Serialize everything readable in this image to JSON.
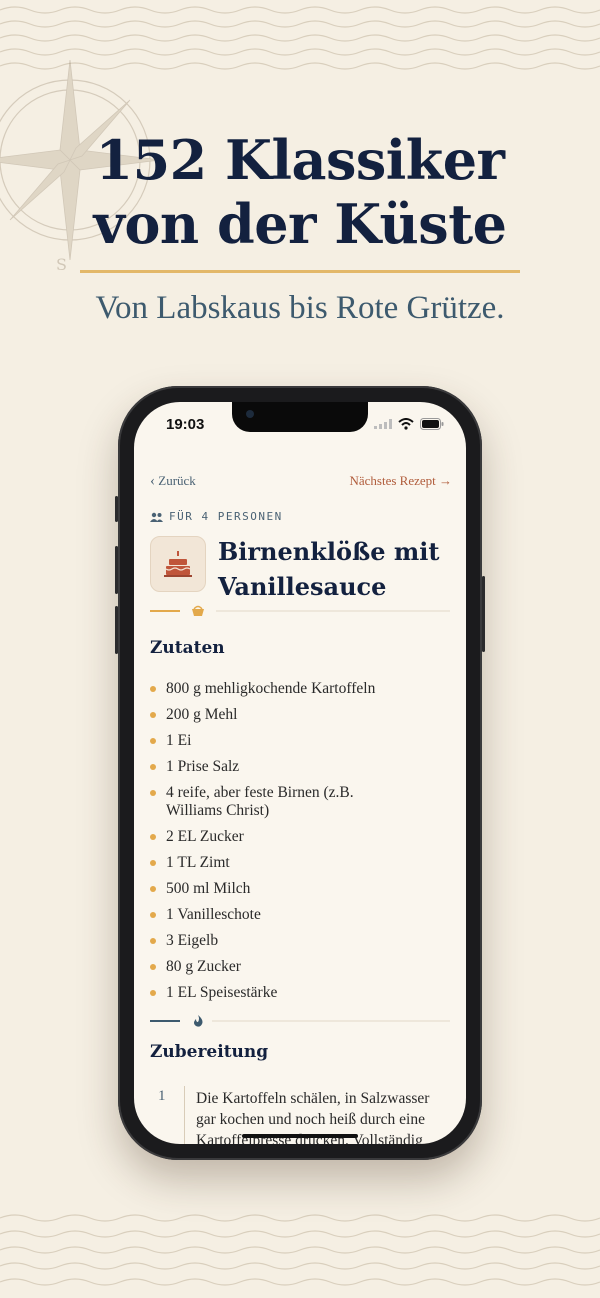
{
  "hero": {
    "headline_line1": "152 Klassiker",
    "headline_line2": "von der Küste",
    "subline": "Von Labskaus bis Rote Grütze.",
    "compass_letter": "S"
  },
  "status_bar": {
    "time": "19:03"
  },
  "nav": {
    "back_label": "Zurück",
    "back_glyph": "‹",
    "next_label": "Nächstes Rezept",
    "next_glyph": "→"
  },
  "recipe": {
    "servings": "FÜR 4 PERSONEN",
    "title": "Birnenklöße mit Vanillesauce",
    "icon": "cake-icon"
  },
  "ingredients": {
    "title": "Zutaten",
    "items": [
      "800 g mehligkochende Kartoffeln",
      "200 g Mehl",
      "1 Ei",
      "1 Prise Salz",
      "4 reife, aber feste Birnen (z.B. Williams Christ)",
      "2 EL Zucker",
      "1 TL Zimt",
      "500 ml Milch",
      "1 Vanilleschote",
      "3 Eigelb",
      "80 g Zucker",
      "1 EL Speisestärke"
    ]
  },
  "preparation": {
    "title": "Zubereitung",
    "steps": [
      {
        "number": "1",
        "text": "Die Kartoffeln schälen, in Salzwasser gar kochen und noch heiß durch eine Kartoffelpresse drücken. Vollständig"
      }
    ]
  },
  "colors": {
    "navy": "#13213f",
    "gold": "#e3b869",
    "terracotta": "#b05c3b",
    "slate": "#3d5a6e",
    "paper": "#f5efe3"
  }
}
